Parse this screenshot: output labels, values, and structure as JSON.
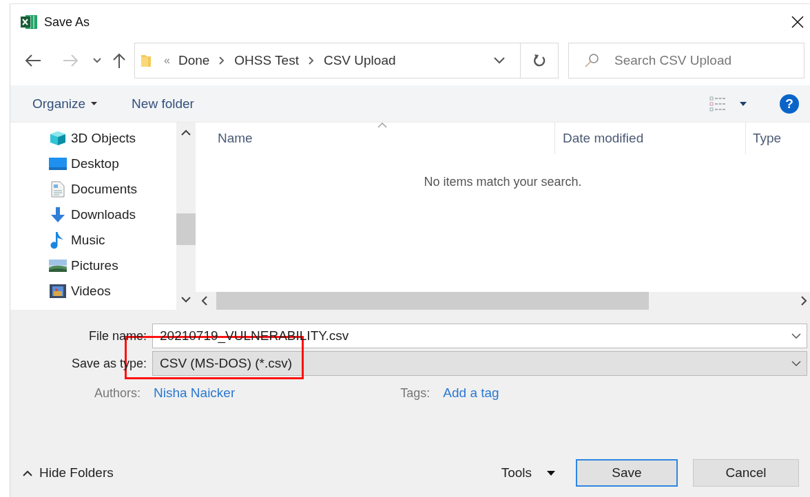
{
  "window": {
    "title": "Save As"
  },
  "navigation": {
    "overflow": "«",
    "path": [
      "Done",
      "OHSS Test",
      "CSV Upload"
    ],
    "search": {
      "placeholder": "Search CSV Upload"
    }
  },
  "toolbar": {
    "organize": "Organize",
    "new_folder": "New folder",
    "help": "?"
  },
  "sidebar": {
    "items": [
      {
        "label": "3D Objects",
        "kind": "cube"
      },
      {
        "label": "Desktop",
        "kind": "desktop"
      },
      {
        "label": "Documents",
        "kind": "documents"
      },
      {
        "label": "Downloads",
        "kind": "downloads"
      },
      {
        "label": "Music",
        "kind": "music"
      },
      {
        "label": "Pictures",
        "kind": "pictures"
      },
      {
        "label": "Videos",
        "kind": "videos"
      }
    ]
  },
  "file_list": {
    "columns": [
      "Name",
      "Date modified",
      "Type"
    ],
    "empty_message": "No items match your search."
  },
  "form": {
    "file_name_label": "File name:",
    "file_name": "20210719_VULNERABILITY.csv",
    "type_label": "Save as type:",
    "type": "CSV (MS-DOS) (*.csv)",
    "authors_label": "Authors:",
    "authors": "Nisha Naicker",
    "tags_label": "Tags:",
    "tags_placeholder": "Add a tag"
  },
  "footer": {
    "hide_folders": "Hide Folders",
    "tools": "Tools",
    "save": "Save",
    "cancel": "Cancel"
  }
}
